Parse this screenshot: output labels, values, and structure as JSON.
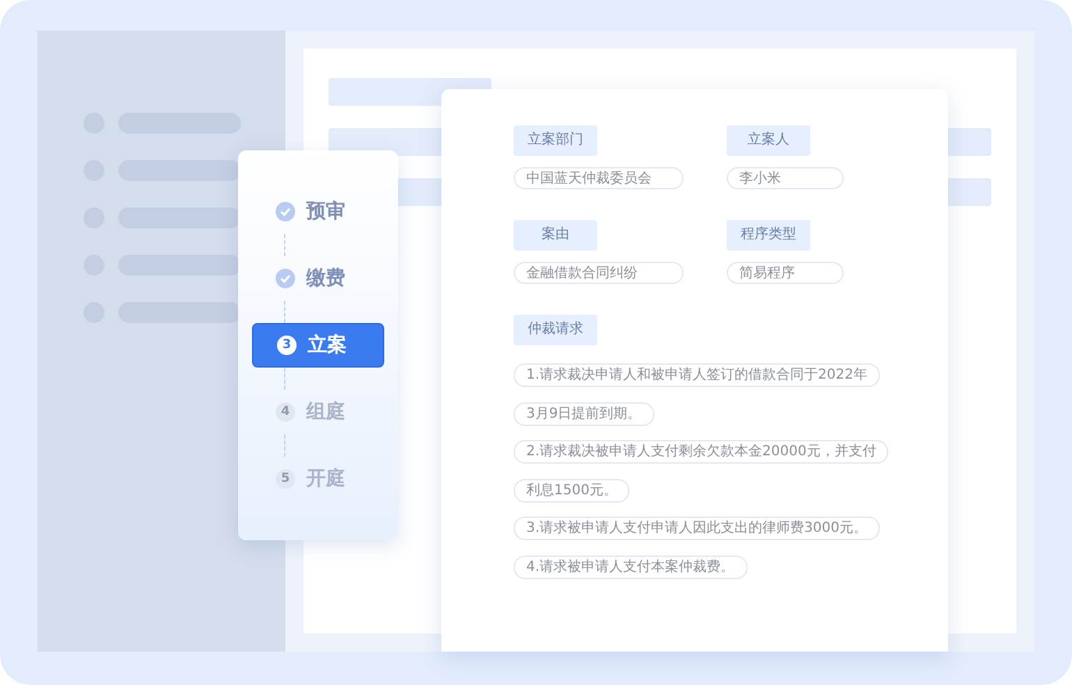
{
  "steps": [
    {
      "label": "预审",
      "done": true,
      "selected": false
    },
    {
      "label": "缴费",
      "done": true,
      "selected": false
    },
    {
      "label": "立案",
      "done": false,
      "selected": true,
      "number": "3"
    },
    {
      "label": "组庭",
      "done": false,
      "selected": false,
      "number": "4"
    },
    {
      "label": "开庭",
      "done": false,
      "selected": false,
      "number": "5"
    }
  ],
  "case_form": {
    "fields": [
      {
        "label": "立案部门",
        "value": "中国蓝天仲裁委员会"
      },
      {
        "label": "立案人",
        "value": "李小米"
      },
      {
        "label": "案由",
        "value": "金融借款合同纠纷"
      },
      {
        "label": "程序类型",
        "value": "简易程序"
      }
    ],
    "request": {
      "label": "仲裁请求",
      "lines": [
        "1.请求裁决申请人和被申请人签订的借款合同于2022年",
        "3月9日提前到期。",
        "2.请求裁决被申请人支付剩余欠款本金20000元，并支付",
        "利息1500元。",
        "3.请求被申请人支付申请人因此支出的律师费3000元。",
        "4.请求被申请人支付本案仲裁费。"
      ]
    }
  }
}
